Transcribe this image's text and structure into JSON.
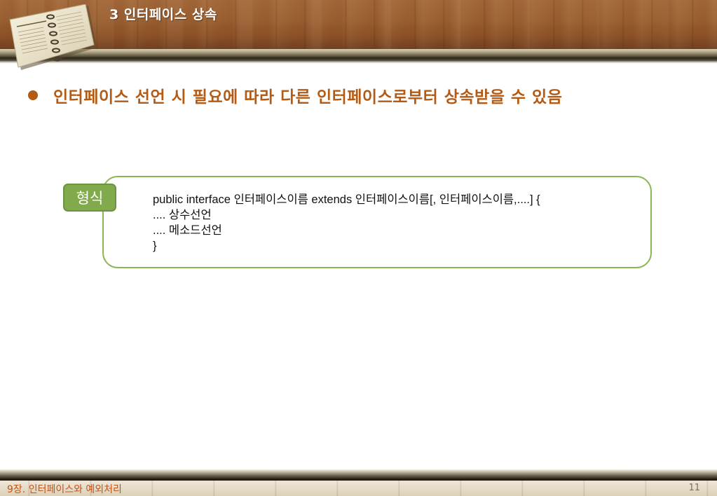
{
  "header": {
    "title_number": "3",
    "title_text": "인터페이스 상속"
  },
  "bullet": {
    "text": "인터페이스 선언 시 필요에 따라 다른 인터페이스로부터 상속받을 수 있음"
  },
  "syntax": {
    "tag": "형식",
    "lines": [
      "public interface 인터페이스이름 extends 인터페이스이름[, 인터페이스이름,....] {",
      ".... 상수선언",
      ".... 메소드선언",
      "}"
    ]
  },
  "footer": {
    "chapter": "9장. 인터페이스와 예외처리",
    "page_number": "11"
  },
  "colors": {
    "accent_brown": "#b35a14",
    "box_green": "#8bb654",
    "tag_green": "#80aa4c",
    "wood": "#9a6032"
  }
}
